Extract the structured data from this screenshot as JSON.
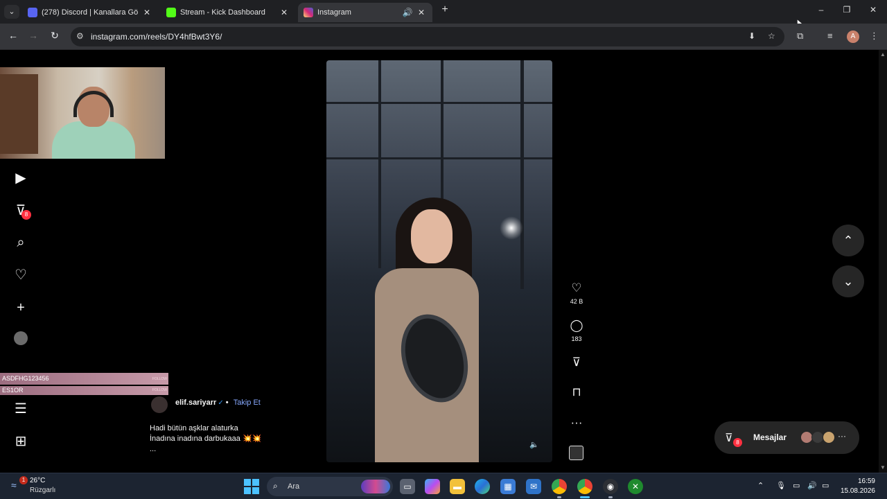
{
  "browser": {
    "tabs": [
      {
        "title": "(278) Discord | Kanallara Gö",
        "favicon_color": "#5865f2",
        "active": false
      },
      {
        "title": "Stream - Kick Dashboard",
        "favicon_color": "#53fc18",
        "active": false
      },
      {
        "title": "Instagram",
        "favicon_color": "#e1306c",
        "active": true
      }
    ],
    "url": "instagram.com/reels/DY4hfBwt3Y6/",
    "profile_initial": "A",
    "new_tab": "+",
    "minimize": "–",
    "restore": "❐",
    "close": "✕",
    "tab_close": "✕"
  },
  "instagram": {
    "nav_badge": "8",
    "reel": {
      "likes": "42 B",
      "comments": "183",
      "username": "elif.sariyarr",
      "verified": "✓",
      "separator": "•",
      "follow_label": "Takip Et",
      "caption": "Hadi bütün aşklar alaturka\nİnadına inadına darbukaaa 💥💥\n..."
    },
    "messages": {
      "label": "Mesajlar",
      "badge": "8",
      "more": "···"
    }
  },
  "stream_overlay": {
    "bar1_name": "ASDFHG123456",
    "bar1_tag": "FOLLOW",
    "bar2_name": "ES1OR",
    "bar2_tag": "FOLLOW"
  },
  "taskbar": {
    "weather_temp": "26°C",
    "weather_desc": "Rüzgarlı",
    "weather_badge": "1",
    "search_placeholder": "Ara",
    "time": "16:59",
    "date": "15.08.2026"
  },
  "colors": {
    "accent": "#4cc2ff",
    "instagram_badge": "#ff3040",
    "follow_link": "#87a9ff"
  }
}
